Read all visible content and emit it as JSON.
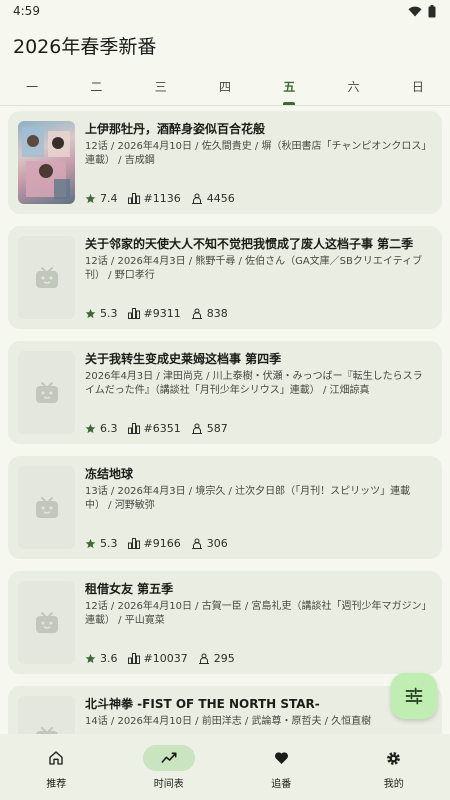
{
  "status_bar": {
    "time": "4:59"
  },
  "app_title": "2026年春季新番",
  "tabs": [
    {
      "label": "一",
      "active": false
    },
    {
      "label": "二",
      "active": false
    },
    {
      "label": "三",
      "active": false
    },
    {
      "label": "四",
      "active": false
    },
    {
      "label": "五",
      "active": true
    },
    {
      "label": "六",
      "active": false
    },
    {
      "label": "日",
      "active": false
    }
  ],
  "anime_list": [
    {
      "title": "上伊那牡丹，酒醉身姿似百合花般",
      "info": "12话 / 2026年4月10日 / 佐久間貴史 / 塀（秋田書店「チャンピオンクロス」連載） / 吉成鋼",
      "rating": "7.4",
      "rank": "#1136",
      "collects": "4456",
      "cover": "art"
    },
    {
      "title": "关于邻家的天使大人不知不觉把我惯成了废人这档子事 第二季",
      "info": "12话 / 2026年4月3日 / 熊野千尋 / 佐伯さん（GA文庫／SBクリエイティブ刊） / 野口孝行",
      "rating": "5.3",
      "rank": "#9311",
      "collects": "838",
      "cover": "placeholder"
    },
    {
      "title": "关于我转生变成史莱姆这档事 第四季",
      "info": "2026年4月3日 / 津田尚克 / 川上泰樹・伏瀬・みっつばー『転生したらスライムだった件』（講談社「月刊少年シリウス」連載） / 江畑諒真",
      "rating": "6.3",
      "rank": "#6351",
      "collects": "587",
      "cover": "placeholder"
    },
    {
      "title": "冻结地球",
      "info": "13话 / 2026年4月3日 / 境宗久 / 辻次夕日郎（「月刊！スピリッツ」連載中） / 河野敏弥",
      "rating": "5.3",
      "rank": "#9166",
      "collects": "306",
      "cover": "placeholder"
    },
    {
      "title": "租借女友 第五季",
      "info": "12话 / 2026年4月10日 / 古賀一臣 / 宮島礼吏（講談社「週刊少年マガジン」連載） / 平山寛菜",
      "rating": "3.6",
      "rank": "#10037",
      "collects": "295",
      "cover": "placeholder"
    },
    {
      "title": "北斗神拳 -FIST OF THE NORTH STAR-",
      "info": "14话 / 2026年4月10日 / 前田洋志 / 武論尊・原哲夫 / 久恒直樹",
      "rating": "",
      "rank": "",
      "collects": "",
      "cover": "placeholder"
    }
  ],
  "fab": {
    "icon": "tune-icon"
  },
  "bottom_nav": [
    {
      "label": "推荐",
      "icon": "home-icon",
      "active": false
    },
    {
      "label": "时间表",
      "icon": "trend-icon",
      "active": true
    },
    {
      "label": "追番",
      "icon": "heart-icon",
      "active": false
    },
    {
      "label": "我的",
      "icon": "gear-icon",
      "active": false
    }
  ],
  "colors": {
    "background": "#f6f8f0",
    "card": "#eaeee2",
    "accent": "#3f6a36",
    "fab": "#c0eeb2",
    "nav_active": "#c9e4bf"
  }
}
